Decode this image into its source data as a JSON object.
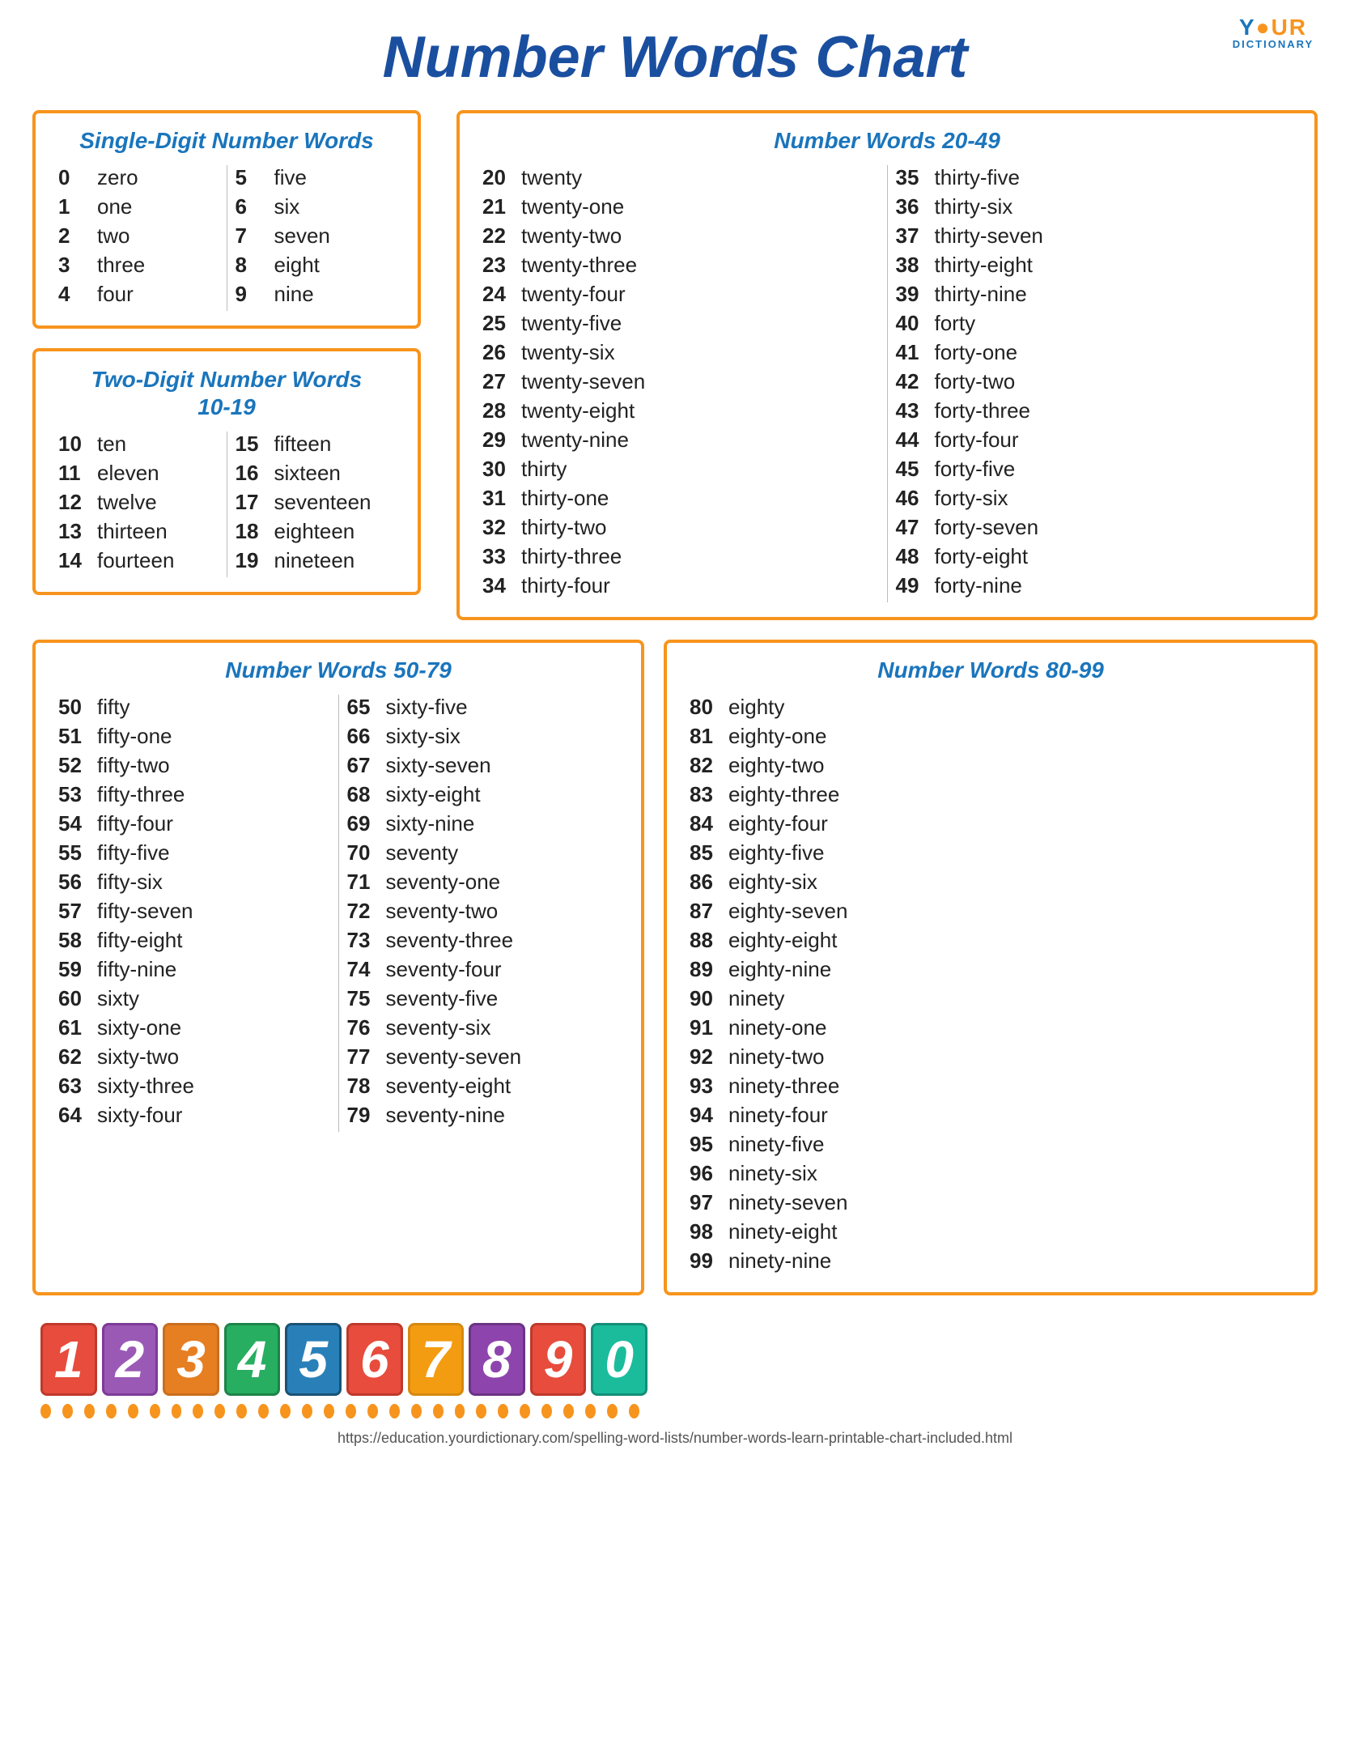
{
  "logo": {
    "your": "Y•UR",
    "dictionary": "DICTIONARY"
  },
  "title": "Number Words Chart",
  "boxes": {
    "single_digit": {
      "title": "Single-Digit Number Words",
      "col1": [
        {
          "num": "0",
          "word": "zero"
        },
        {
          "num": "1",
          "word": "one"
        },
        {
          "num": "2",
          "word": "two"
        },
        {
          "num": "3",
          "word": "three"
        },
        {
          "num": "4",
          "word": "four"
        }
      ],
      "col2": [
        {
          "num": "5",
          "word": "five"
        },
        {
          "num": "6",
          "word": "six"
        },
        {
          "num": "7",
          "word": "seven"
        },
        {
          "num": "8",
          "word": "eight"
        },
        {
          "num": "9",
          "word": "nine"
        }
      ]
    },
    "two_digit": {
      "title": "Two-Digit Number Words\n10-19",
      "col1": [
        {
          "num": "10",
          "word": "ten"
        },
        {
          "num": "11",
          "word": "eleven"
        },
        {
          "num": "12",
          "word": "twelve"
        },
        {
          "num": "13",
          "word": "thirteen"
        },
        {
          "num": "14",
          "word": "fourteen"
        }
      ],
      "col2": [
        {
          "num": "15",
          "word": "fifteen"
        },
        {
          "num": "16",
          "word": "sixteen"
        },
        {
          "num": "17",
          "word": "seventeen"
        },
        {
          "num": "18",
          "word": "eighteen"
        },
        {
          "num": "19",
          "word": "nineteen"
        }
      ]
    },
    "nw2049": {
      "title": "Number Words 20-49",
      "col1": [
        {
          "num": "20",
          "word": "twenty"
        },
        {
          "num": "21",
          "word": "twenty-one"
        },
        {
          "num": "22",
          "word": "twenty-two"
        },
        {
          "num": "23",
          "word": "twenty-three"
        },
        {
          "num": "24",
          "word": "twenty-four"
        },
        {
          "num": "25",
          "word": "twenty-five"
        },
        {
          "num": "26",
          "word": "twenty-six"
        },
        {
          "num": "27",
          "word": "twenty-seven"
        },
        {
          "num": "28",
          "word": "twenty-eight"
        },
        {
          "num": "29",
          "word": "twenty-nine"
        },
        {
          "num": "30",
          "word": "thirty"
        },
        {
          "num": "31",
          "word": "thirty-one"
        },
        {
          "num": "32",
          "word": "thirty-two"
        },
        {
          "num": "33",
          "word": "thirty-three"
        },
        {
          "num": "34",
          "word": "thirty-four"
        }
      ],
      "col2": [
        {
          "num": "35",
          "word": "thirty-five"
        },
        {
          "num": "36",
          "word": "thirty-six"
        },
        {
          "num": "37",
          "word": "thirty-seven"
        },
        {
          "num": "38",
          "word": "thirty-eight"
        },
        {
          "num": "39",
          "word": "thirty-nine"
        },
        {
          "num": "40",
          "word": "forty"
        },
        {
          "num": "41",
          "word": "forty-one"
        },
        {
          "num": "42",
          "word": "forty-two"
        },
        {
          "num": "43",
          "word": "forty-three"
        },
        {
          "num": "44",
          "word": "forty-four"
        },
        {
          "num": "45",
          "word": "forty-five"
        },
        {
          "num": "46",
          "word": "forty-six"
        },
        {
          "num": "47",
          "word": "forty-seven"
        },
        {
          "num": "48",
          "word": "forty-eight"
        },
        {
          "num": "49",
          "word": "forty-nine"
        }
      ]
    },
    "nw5079": {
      "title": "Number Words 50-79",
      "col1": [
        {
          "num": "50",
          "word": "fifty"
        },
        {
          "num": "51",
          "word": "fifty-one"
        },
        {
          "num": "52",
          "word": "fifty-two"
        },
        {
          "num": "53",
          "word": "fifty-three"
        },
        {
          "num": "54",
          "word": "fifty-four"
        },
        {
          "num": "55",
          "word": "fifty-five"
        },
        {
          "num": "56",
          "word": "fifty-six"
        },
        {
          "num": "57",
          "word": "fifty-seven"
        },
        {
          "num": "58",
          "word": "fifty-eight"
        },
        {
          "num": "59",
          "word": "fifty-nine"
        },
        {
          "num": "60",
          "word": "sixty"
        },
        {
          "num": "61",
          "word": "sixty-one"
        },
        {
          "num": "62",
          "word": "sixty-two"
        },
        {
          "num": "63",
          "word": "sixty-three"
        },
        {
          "num": "64",
          "word": "sixty-four"
        }
      ],
      "col2": [
        {
          "num": "65",
          "word": "sixty-five"
        },
        {
          "num": "66",
          "word": "sixty-six"
        },
        {
          "num": "67",
          "word": "sixty-seven"
        },
        {
          "num": "68",
          "word": "sixty-eight"
        },
        {
          "num": "69",
          "word": "sixty-nine"
        },
        {
          "num": "70",
          "word": "seventy"
        },
        {
          "num": "71",
          "word": "seventy-one"
        },
        {
          "num": "72",
          "word": "seventy-two"
        },
        {
          "num": "73",
          "word": "seventy-three"
        },
        {
          "num": "74",
          "word": "seventy-four"
        },
        {
          "num": "75",
          "word": "seventy-five"
        },
        {
          "num": "76",
          "word": "seventy-six"
        },
        {
          "num": "77",
          "word": "seventy-seven"
        },
        {
          "num": "78",
          "word": "seventy-eight"
        },
        {
          "num": "79",
          "word": "seventy-nine"
        }
      ]
    },
    "nw8099": {
      "title": "Number Words 80-99",
      "col1": [
        {
          "num": "80",
          "word": "eighty"
        },
        {
          "num": "81",
          "word": "eighty-one"
        },
        {
          "num": "82",
          "word": "eighty-two"
        },
        {
          "num": "83",
          "word": "eighty-three"
        },
        {
          "num": "84",
          "word": "eighty-four"
        },
        {
          "num": "85",
          "word": "eighty-five"
        },
        {
          "num": "86",
          "word": "eighty-six"
        },
        {
          "num": "87",
          "word": "eighty-seven"
        },
        {
          "num": "88",
          "word": "eighty-eight"
        },
        {
          "num": "89",
          "word": "eighty-nine"
        },
        {
          "num": "90",
          "word": "ninety"
        },
        {
          "num": "91",
          "word": "ninety-one"
        },
        {
          "num": "92",
          "word": "ninety-two"
        },
        {
          "num": "93",
          "word": "ninety-three"
        },
        {
          "num": "94",
          "word": "ninety-four"
        },
        {
          "num": "95",
          "word": "ninety-five"
        },
        {
          "num": "96",
          "word": "ninety-six"
        },
        {
          "num": "97",
          "word": "ninety-seven"
        },
        {
          "num": "98",
          "word": "ninety-eight"
        },
        {
          "num": "99",
          "word": "ninety-nine"
        }
      ]
    }
  },
  "colorful_digits": [
    {
      "digit": "1",
      "color": "#e74c3c",
      "border": "#c0392b"
    },
    {
      "digit": "2",
      "color": "#9b59b6",
      "border": "#7d3c98"
    },
    {
      "digit": "3",
      "color": "#e67e22",
      "border": "#ca6f1e"
    },
    {
      "digit": "4",
      "color": "#27ae60",
      "border": "#1e8449"
    },
    {
      "digit": "5",
      "color": "#2980b9",
      "border": "#1a5276"
    },
    {
      "digit": "6",
      "color": "#e74c3c",
      "border": "#c0392b"
    },
    {
      "digit": "7",
      "color": "#f39c12",
      "border": "#d68910"
    },
    {
      "digit": "8",
      "color": "#8e44ad",
      "border": "#6c3483"
    },
    {
      "digit": "9",
      "color": "#e74c3c",
      "border": "#c0392b"
    },
    {
      "digit": "0",
      "color": "#1abc9c",
      "border": "#148f77"
    }
  ],
  "footer_url": "https://education.yourdictionary.com/spelling-word-lists/number-words-learn-printable-chart-included.html"
}
